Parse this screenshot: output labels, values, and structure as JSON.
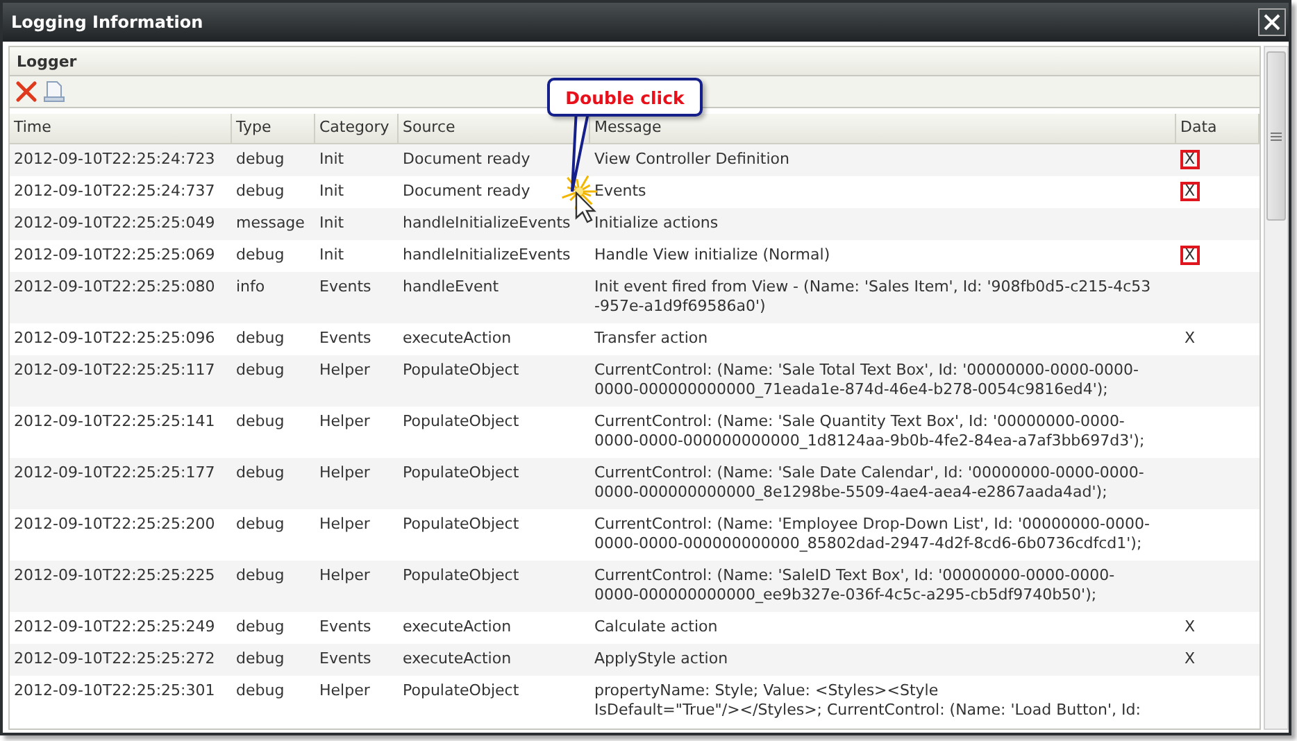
{
  "window": {
    "title": "Logging Information"
  },
  "panel": {
    "title": "Logger"
  },
  "toolbar": [
    {
      "kind": "clear"
    },
    {
      "kind": "export"
    }
  ],
  "callout": {
    "text": "Double click"
  },
  "table": {
    "columns": [
      "Time",
      "Type",
      "Category",
      "Source",
      "Message",
      "Data"
    ],
    "rows": [
      {
        "time": "2012-09-10T22:25:24:723",
        "type": "debug",
        "category": "Init",
        "source": "Document ready",
        "message": "View Controller Definition",
        "data": "X",
        "highlighted": true
      },
      {
        "time": "2012-09-10T22:25:24:737",
        "type": "debug",
        "category": "Init",
        "source": "Document ready",
        "message": "Events",
        "data": "X",
        "highlighted": true
      },
      {
        "time": "2012-09-10T22:25:25:049",
        "type": "message",
        "category": "Init",
        "source": "handleInitializeEvents",
        "message": "Initialize actions"
      },
      {
        "time": "2012-09-10T22:25:25:069",
        "type": "debug",
        "category": "Init",
        "source": "handleInitializeEvents",
        "message": "Handle View initialize (Normal)",
        "data": "X",
        "highlighted": true
      },
      {
        "time": "2012-09-10T22:25:25:080",
        "type": "info",
        "category": "Events",
        "source": "handleEvent",
        "message": "Init event fired from View - (Name: 'Sales Item', Id: '908fb0d5-c215-4c53\n-957e-a1d9f69586a0')"
      },
      {
        "time": "2012-09-10T22:25:25:096",
        "type": "debug",
        "category": "Events",
        "source": "executeAction",
        "message": "Transfer action",
        "data": "X",
        "highlighted": false
      },
      {
        "time": "2012-09-10T22:25:25:117",
        "type": "debug",
        "category": "Helper",
        "source": "PopulateObject",
        "message": "CurrentControl: (Name: 'Sale Total Text Box', Id: '00000000-0000-0000-\n0000-000000000000_71eada1e-874d-46e4-b278-0054c9816ed4');"
      },
      {
        "time": "2012-09-10T22:25:25:141",
        "type": "debug",
        "category": "Helper",
        "source": "PopulateObject",
        "message": "CurrentControl: (Name: 'Sale Quantity Text Box', Id: '00000000-0000-\n0000-0000-000000000000_1d8124aa-9b0b-4fe2-84ea-a7af3bb697d3');"
      },
      {
        "time": "2012-09-10T22:25:25:177",
        "type": "debug",
        "category": "Helper",
        "source": "PopulateObject",
        "message": "CurrentControl: (Name: 'Sale Date Calendar', Id: '00000000-0000-0000-\n0000-000000000000_8e1298be-5509-4ae4-aea4-e2867aada4ad');"
      },
      {
        "time": "2012-09-10T22:25:25:200",
        "type": "debug",
        "category": "Helper",
        "source": "PopulateObject",
        "message": "CurrentControl: (Name: 'Employee Drop-Down List', Id: '00000000-0000-\n0000-0000-000000000000_85802dad-2947-4d2f-8cd6-6b0736cdfcd1');"
      },
      {
        "time": "2012-09-10T22:25:25:225",
        "type": "debug",
        "category": "Helper",
        "source": "PopulateObject",
        "message": "CurrentControl: (Name: 'SaleID Text Box', Id: '00000000-0000-0000-\n0000-000000000000_ee9b327e-036f-4c5c-a295-cb5df9740b50');"
      },
      {
        "time": "2012-09-10T22:25:25:249",
        "type": "debug",
        "category": "Events",
        "source": "executeAction",
        "message": "Calculate action",
        "data": "X",
        "highlighted": false
      },
      {
        "time": "2012-09-10T22:25:25:272",
        "type": "debug",
        "category": "Events",
        "source": "executeAction",
        "message": "ApplyStyle action",
        "data": "X",
        "highlighted": false
      },
      {
        "time": "2012-09-10T22:25:25:301",
        "type": "debug",
        "category": "Helper",
        "source": "PopulateObject",
        "message": "propertyName: Style; Value: <Styles><Style\nIsDefault=\"True\"/></Styles>; CurrentControl: (Name: 'Load Button', Id:"
      }
    ]
  }
}
